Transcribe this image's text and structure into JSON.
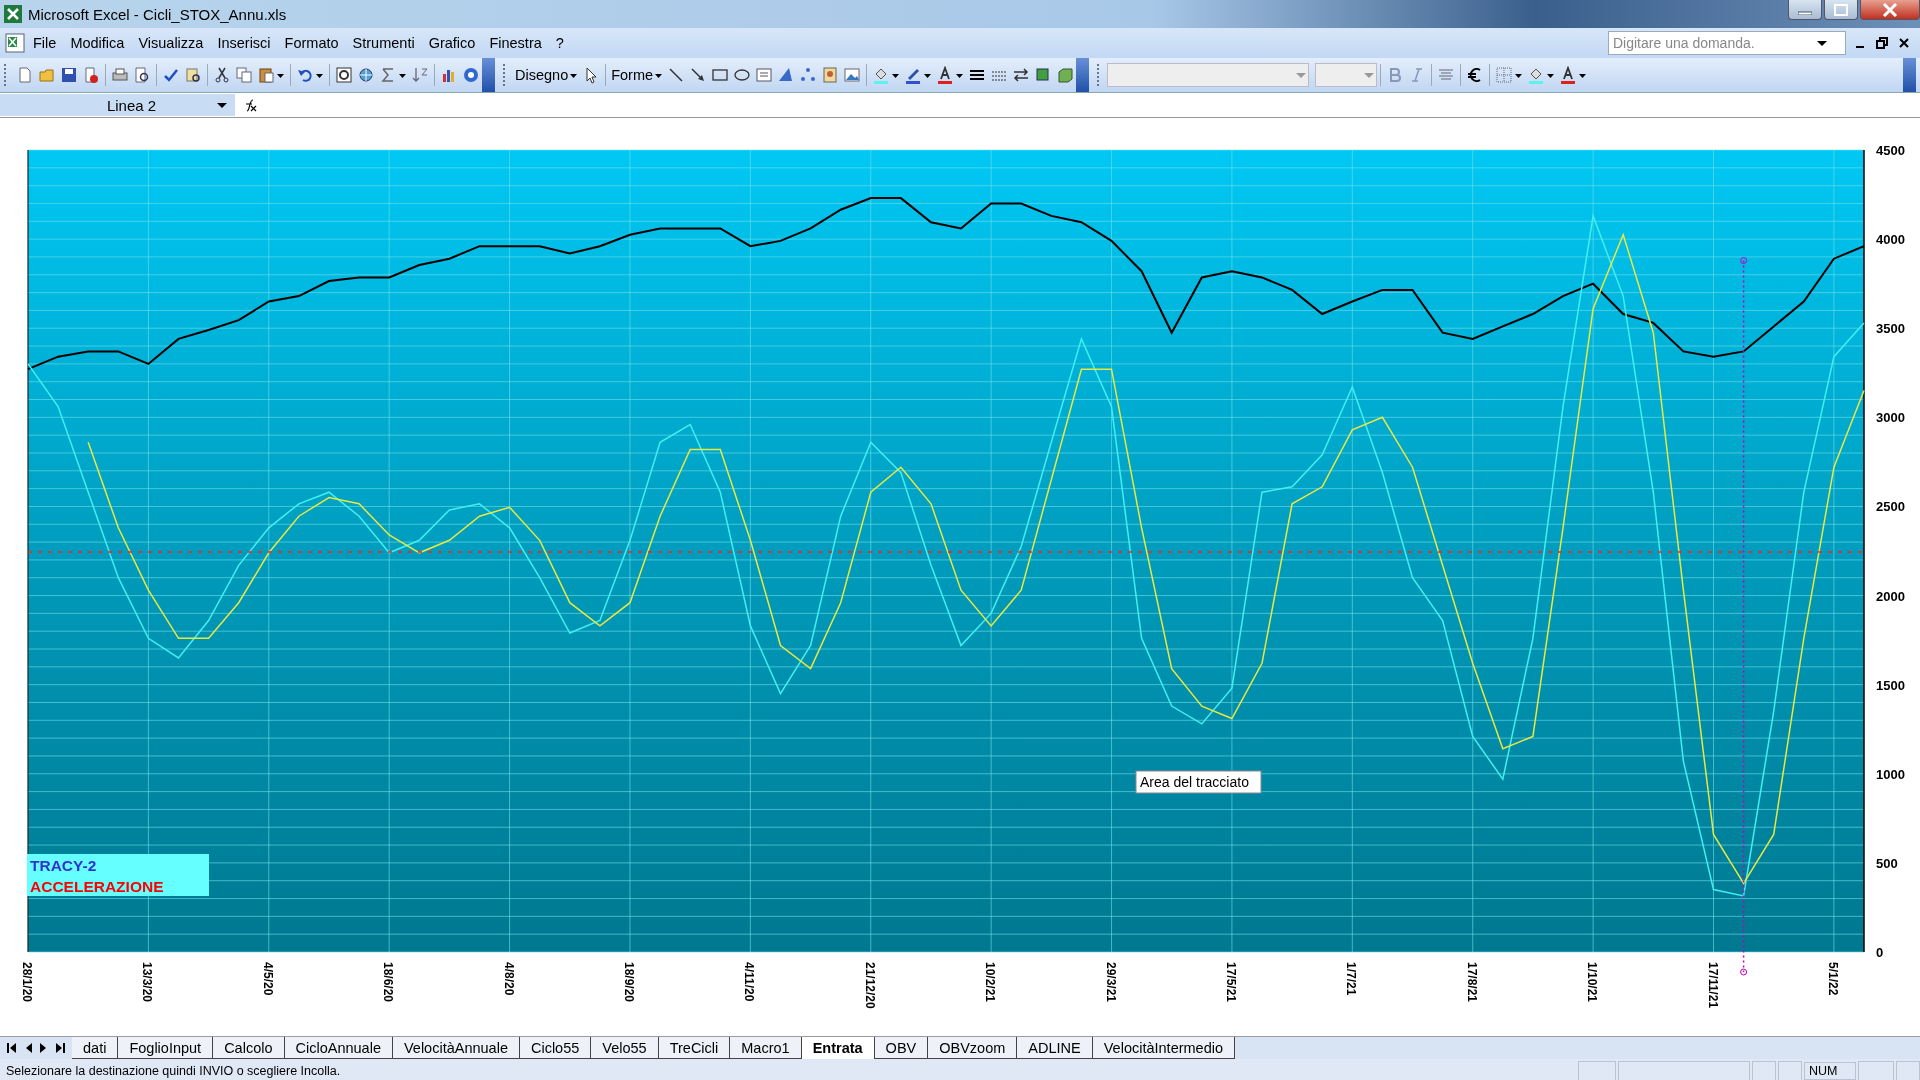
{
  "window": {
    "title": "Microsoft Excel - Cicli_STOX_Annu.xls"
  },
  "menu": [
    "File",
    "Modifica",
    "Visualizza",
    "Inserisci",
    "Formato",
    "Strumenti",
    "Grafico",
    "Finestra",
    "?"
  ],
  "help_field": {
    "placeholder": "Digitare una domanda."
  },
  "toolbar": {
    "drawing_menu": "Disegno",
    "shapes_menu": "Forme"
  },
  "formula_bar": {
    "name_box": "Linea 2"
  },
  "chart": {
    "chart_data": {
      "type": "line",
      "categories": [
        "28/1/20",
        null,
        null,
        null,
        "13/3/20",
        null,
        null,
        null,
        "4/5/20",
        null,
        null,
        null,
        "18/6/20",
        null,
        null,
        null,
        "4/8/20",
        null,
        null,
        null,
        "18/9/20",
        null,
        null,
        null,
        "4/11/20",
        null,
        null,
        null,
        "21/12/20",
        null,
        null,
        null,
        "10/2/21",
        null,
        null,
        null,
        "29/3/21",
        null,
        null,
        null,
        "17/5/21",
        null,
        null,
        null,
        "1/7/21",
        null,
        null,
        null,
        "17/8/21",
        null,
        null,
        null,
        "1/10/21",
        null,
        null,
        null,
        "17/11/21",
        null,
        null,
        null,
        "5/1/22",
        null
      ],
      "ylim": [
        0,
        4500
      ],
      "yticks": [
        0,
        500,
        1000,
        1500,
        2000,
        2500,
        3000,
        3500,
        4000,
        4500
      ],
      "series": [
        {
          "color": "#000000",
          "values": [
            3270,
            3340,
            3370,
            3370,
            3300,
            3440,
            3490,
            3545,
            3650,
            3680,
            3765,
            3785,
            3785,
            3855,
            3890,
            3960,
            3960,
            3960,
            3920,
            3960,
            4025,
            4060,
            4060,
            4060,
            3960,
            3990,
            4060,
            4165,
            4230,
            4230,
            4095,
            4060,
            4200,
            4200,
            4130,
            4095,
            3990,
            3820,
            3475,
            3785,
            3820,
            3785,
            3715,
            3580,
            3650,
            3715,
            3715,
            3475,
            3440,
            3510,
            3580,
            3680,
            3750,
            3580,
            3530,
            3370,
            3340,
            3370,
            3510,
            3650,
            3890,
            3960
          ]
        },
        {
          "color": "#40f0f0",
          "values": [
            3300,
            3060,
            2580,
            2100,
            1760,
            1650,
            1860,
            2170,
            2380,
            2515,
            2580,
            2445,
            2240,
            2310,
            2480,
            2515,
            2380,
            2100,
            1790,
            1860,
            2310,
            2860,
            2960,
            2580,
            1830,
            1450,
            1720,
            2445,
            2860,
            2690,
            2170,
            1720,
            1900,
            2275,
            2860,
            3440,
            3060,
            1760,
            1380,
            1280,
            1480,
            2580,
            2610,
            2790,
            3170,
            2690,
            2100,
            1860,
            1210,
            970,
            1760,
            3060,
            4130,
            3680,
            2580,
            1070,
            350,
            315,
            1350,
            2580,
            3340,
            3530
          ]
        },
        {
          "color": "#e8e840",
          "values": [
            null,
            null,
            2860,
            2380,
            2030,
            1760,
            1760,
            1960,
            2240,
            2445,
            2550,
            2515,
            2340,
            2240,
            2310,
            2445,
            2495,
            2310,
            1960,
            1830,
            1960,
            2445,
            2820,
            2820,
            2310,
            1720,
            1590,
            1960,
            2580,
            2720,
            2515,
            2030,
            1830,
            2030,
            2650,
            3270,
            3270,
            2380,
            1590,
            1380,
            1310,
            1620,
            2515,
            2610,
            2930,
            3000,
            2720,
            2170,
            1620,
            1140,
            1210,
            2380,
            3610,
            4025,
            3475,
            2030,
            660,
            385,
            660,
            1760,
            2720,
            3150
          ]
        }
      ],
      "grid": true,
      "ref_lines": [
        {
          "axis": "y",
          "value": 2245,
          "color": "#ff2020"
        }
      ]
    },
    "legend_box": [
      {
        "text": "TRACY-2",
        "color": "#3333cc"
      },
      {
        "text": "ACCELERAZIONE",
        "color": "#ff0000"
      }
    ],
    "tooltip": "Area del tracciato"
  },
  "sheet_tabs": [
    {
      "label": "dati",
      "selected": false
    },
    {
      "label": "FoglioInput",
      "selected": false
    },
    {
      "label": "Calcolo",
      "selected": false
    },
    {
      "label": "CicloAnnuale",
      "selected": false
    },
    {
      "label": "VelocitàAnnuale",
      "selected": false
    },
    {
      "label": "Ciclo55",
      "selected": false
    },
    {
      "label": "Velo55",
      "selected": false
    },
    {
      "label": "TreCicli",
      "selected": false
    },
    {
      "label": "Macro1",
      "selected": false
    },
    {
      "label": "Entrata",
      "selected": true
    },
    {
      "label": "OBV",
      "selected": false
    },
    {
      "label": "OBVzoom",
      "selected": false
    },
    {
      "label": "ADLINE",
      "selected": false
    },
    {
      "label": "VelocitàIntermedio",
      "selected": false
    }
  ],
  "status_bar": {
    "message": "Selezionare la destinazione quindi INVIO o scegliere Incolla.",
    "indicator": "NUM"
  }
}
